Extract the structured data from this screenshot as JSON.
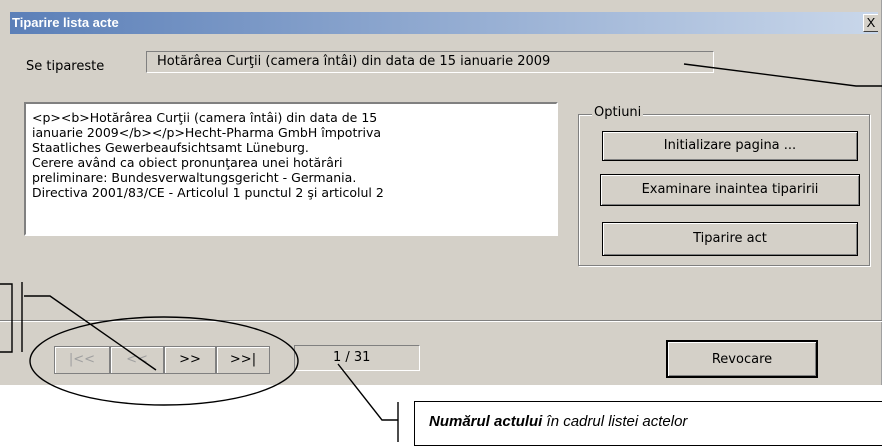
{
  "window": {
    "title": "Tiparire lista acte",
    "close_symbol": "X"
  },
  "print_row": {
    "label": "Se tipareste",
    "value": "Hotărârea Curţii (camera întâi) din data de 15 ianuarie 2009"
  },
  "content_text": "<p><b>Hotărârea Curţii (camera întâi) din data de 15\nianuarie 2009</b></p>Hecht-Pharma GmbH împotriva\nStaatliches Gewerbeaufsichtsamt Lüneburg.\nCerere având ca obiect pronunţarea unei hotărâri\npreliminare: Bundesverwaltungsgericht - Germania.\nDirectiva 2001/83/CE - Articolul 1 punctul 2 şi articolul 2",
  "options": {
    "legend": "Optiuni",
    "init_page": "Initializare pagina ...",
    "preview": "Examinare inaintea tiparirii",
    "print": "Tiparire act"
  },
  "navigation": {
    "first": "|<<",
    "prev": "<<",
    "next": ">>",
    "last": ">>|",
    "counter": "1 / 31"
  },
  "cancel": "Revocare",
  "callout": {
    "bold": "Numărul actului",
    "rest": " în cadrul listei actelor"
  }
}
